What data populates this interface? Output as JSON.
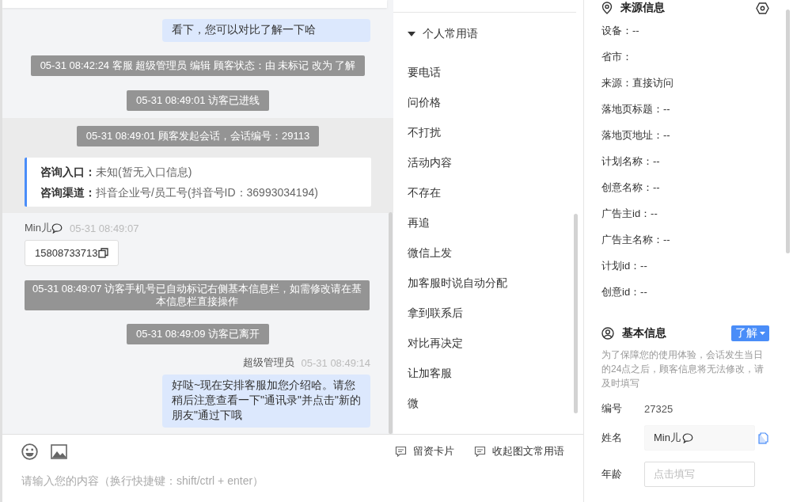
{
  "chat": {
    "messages": [
      {
        "kind": "outgoing",
        "text": "看下，您可以对比了解一下哈"
      },
      {
        "kind": "notice",
        "text": "05-31 08:42:24 客服 超级管理员 编辑 顾客状态：由 未标记 改为 了解"
      },
      {
        "kind": "notice",
        "text": "05-31 08:49:01 访客已进线"
      },
      {
        "kind": "session",
        "notice": "05-31 08:49:01 顾客发起会话，会话编号：29113",
        "fields": [
          {
            "label": "咨询入口：",
            "value": "未知(暂无入口信息)"
          },
          {
            "label": "咨询渠道：",
            "value": "抖音企业号/员工号(抖音号ID：36993034194)"
          }
        ]
      },
      {
        "kind": "incoming",
        "sender": "Min儿",
        "time": "05-31 08:49:07",
        "text": "15808733713"
      },
      {
        "kind": "notice",
        "text": "05-31 08:49:07 访客手机号已自动标记右侧基本信息栏，如需修改请在基本信息栏直接操作"
      },
      {
        "kind": "notice",
        "text": "05-31 08:49:09 访客已离开"
      },
      {
        "kind": "outgoing",
        "sender": "超级管理员",
        "time": "05-31 08:49:14",
        "text": "好哒~现在安排客服加您介绍哈。请您稍后注意查看一下\"通讯录\"并点击\"新的朋友\"通过下哦"
      }
    ]
  },
  "phrases": {
    "group": {
      "label": "个人常用语",
      "expanded": true
    },
    "items": [
      "要电话",
      "问价格",
      "不打扰",
      "活动内容",
      "不存在",
      "再追",
      "微信上发",
      "加客服时说自动分配",
      "拿到联系后",
      "对比再决定",
      "让加客服",
      "微"
    ]
  },
  "composer": {
    "tools": [
      "留资卡片",
      "收起图文常用语"
    ],
    "placeholder": "请输入您的内容（换行快捷键：shift/ctrl + enter）"
  },
  "source": {
    "title": "来源信息",
    "fields": [
      "设备：--",
      "省市：",
      "来源：直接访问",
      "落地页标题：--",
      "落地页地址：--",
      "计划名称：--",
      "创意名称：--",
      "广告主id：--",
      "广告主名称：--",
      "计划id：--",
      "创意id：--"
    ]
  },
  "basic": {
    "title": "基本信息",
    "status": "了解",
    "notice": "为了保障您的使用体验，会话发生当日的24点之后，顾客信息将无法修改，请及时填写",
    "fields": [
      {
        "kind": "text",
        "label": "编号",
        "value": "27325"
      },
      {
        "kind": "input",
        "label": "姓名",
        "value": "Min儿"
      },
      {
        "kind": "input",
        "label": "年龄",
        "placeholder": "点击填写"
      }
    ]
  }
}
